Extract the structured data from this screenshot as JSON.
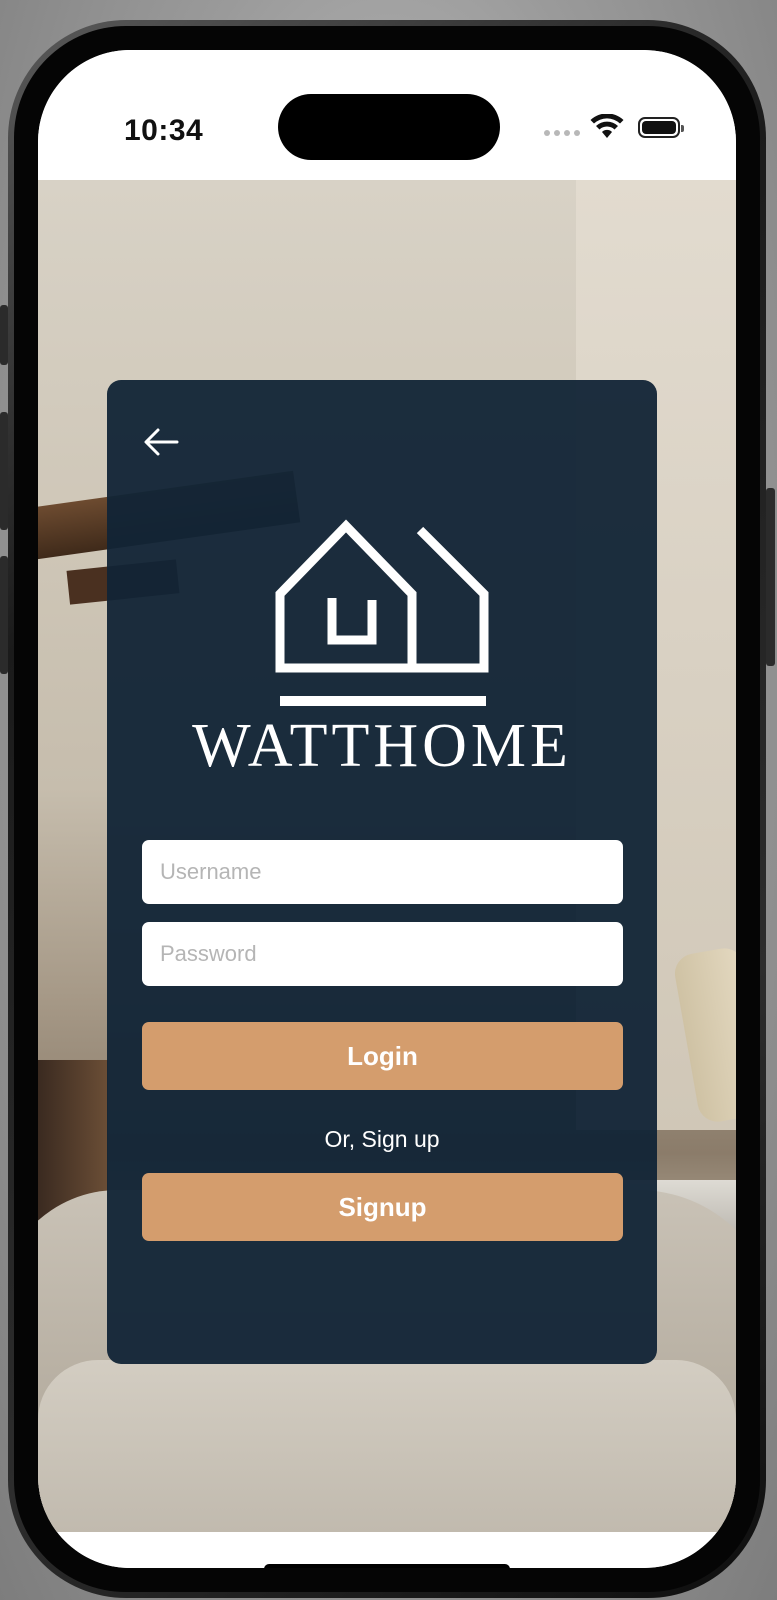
{
  "status_bar": {
    "time": "10:34",
    "icons": [
      "signal-icon",
      "wifi-icon",
      "battery-icon"
    ]
  },
  "login_card": {
    "back_icon": "back-arrow-icon",
    "logo_icon": "house-logo-icon",
    "brand_name": "WATTHOME",
    "username": {
      "value": "",
      "placeholder": "Username"
    },
    "password": {
      "value": "",
      "placeholder": "Password"
    },
    "login_label": "Login",
    "or_text": "Or, Sign up",
    "signup_label": "Signup"
  },
  "colors": {
    "card_bg": "#112436",
    "button_accent": "#d49d6d",
    "placeholder": "#b5b5b5"
  }
}
